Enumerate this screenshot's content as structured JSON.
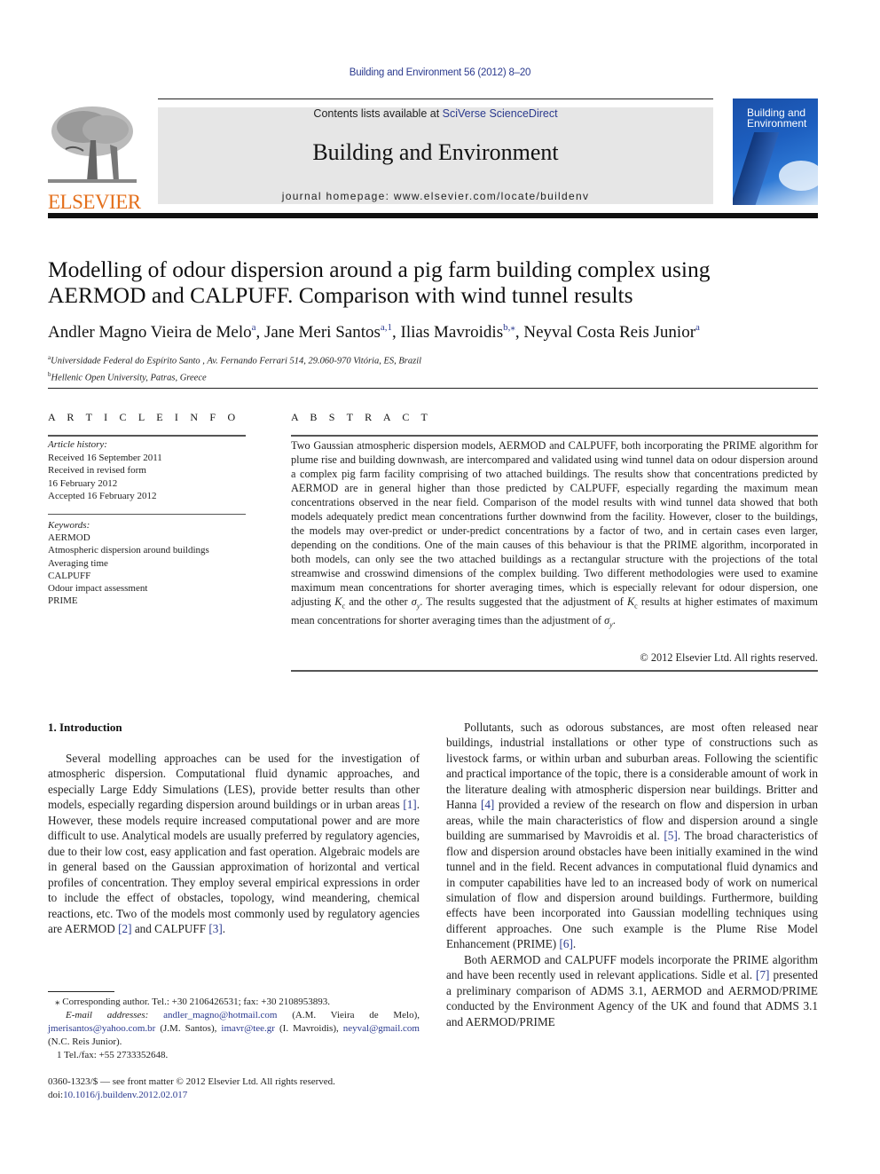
{
  "header": {
    "journal_ref": "Building and Environment 56 (2012) 8–20",
    "contents_prefix": "Contents lists available at ",
    "contents_link": "SciVerse ScienceDirect",
    "journal_title": "Building and Environment",
    "homepage": "journal homepage: www.elsevier.com/locate/buildenv",
    "publisher_logo_text": "ELSEVIER",
    "cover_title_line1": "Building and",
    "cover_title_line2": "Environment",
    "colors": {
      "link": "#2b3a8e",
      "elsevier_orange": "#e46f1b",
      "masthead_bg": "#e6e6e6"
    }
  },
  "article": {
    "title_line1": "Modelling of odour dispersion around a pig farm building complex using",
    "title_line2": "AERMOD and CALPUFF. Comparison with wind tunnel results",
    "authors": [
      {
        "name": "Andler Magno Vieira de Melo",
        "sup": "a"
      },
      {
        "name": "Jane Meri Santos",
        "sup": "a,1"
      },
      {
        "name": "Ilias Mavroidis",
        "sup": "b,⁎"
      },
      {
        "name": "Neyval Costa Reis Junior",
        "sup": "a"
      }
    ],
    "affiliations": [
      {
        "mark": "a",
        "text": "Universidade Federal do Espírito Santo , Av. Fernando Ferrari 514, 29.060-970 Vitória, ES, Brazil"
      },
      {
        "mark": "b",
        "text": "Hellenic Open University, Patras, Greece"
      }
    ]
  },
  "article_info": {
    "heading": "A R T I C L E   I N F O",
    "history_label": "Article history:",
    "history": [
      "Received 16 September 2011",
      "Received in revised form",
      "16 February 2012",
      "Accepted 16 February 2012"
    ],
    "keywords_label": "Keywords:",
    "keywords": [
      "AERMOD",
      "Atmospheric dispersion around buildings",
      "Averaging time",
      "CALPUFF",
      "Odour impact assessment",
      "PRIME"
    ]
  },
  "abstract": {
    "heading": "A B S T R A C T",
    "text_part1": "Two Gaussian atmospheric dispersion models, AERMOD and CALPUFF, both incorporating the PRIME algorithm for plume rise and building downwash, are intercompared and validated using wind tunnel data on odour dispersion around a complex pig farm facility comprising of two attached buildings. The results show that concentrations predicted by AERMOD are in general higher than those predicted by CALPUFF, especially regarding the maximum mean concentrations observed in the near field. Comparison of the model results with wind tunnel data showed that both models adequately predict mean concentrations further downwind from the facility. However, closer to the buildings, the models may over-predict or under-predict concentrations by a factor of two, and in certain cases even larger, depending on the conditions. One of the main causes of this behaviour is that the PRIME algorithm, incorporated in both models, can only see the two attached buildings as a rectangular structure with the projections of the total streamwise and crosswind dimensions of the complex building. Two different methodologies were used to examine maximum mean concentrations for shorter averaging times, which is especially relevant for odour dispersion, one adjusting ",
    "kc": "K",
    "kc_sub": "c",
    "text_part2": " and the other ",
    "sigma": "σ",
    "sigma_sub": "y",
    "text_part3": ". The results suggested that the adjustment of ",
    "text_part4": " results at higher estimates of maximum mean concentrations for shorter averaging times than the adjustment of ",
    "text_part5": ".",
    "copyright": "© 2012 Elsevier Ltd. All rights reserved."
  },
  "introduction": {
    "heading": "1.  Introduction",
    "left_p1_a": "Several modelling approaches can be used for the investigation of atmospheric dispersion. Computational fluid dynamic approaches, and especially Large Eddy Simulations (LES), provide better results than other models, especially regarding dispersion around buildings or in urban areas ",
    "ref1": "[1]",
    "left_p1_b": ". However, these models require increased computational power and are more difficult to use. Analytical models are usually preferred by regulatory agencies, due to their low cost, easy application and fast operation. Algebraic models are in general based on the Gaussian approximation of horizontal and vertical profiles of concentration. They employ several empirical expressions in order to include the effect of obstacles, topology, wind meandering, chemical reactions, etc. Two of the models most commonly used by regulatory agencies are AERMOD ",
    "ref2": "[2]",
    "left_p1_c": " and CALPUFF ",
    "ref3": "[3]",
    "left_p1_d": ".",
    "right_p1_a": "Pollutants, such as odorous substances, are most often released near buildings, industrial installations or other type of constructions such as livestock farms, or within urban and suburban areas. Following the scientific and practical importance of the topic, there is a considerable amount of work in the literature dealing with atmospheric dispersion near buildings. Britter and Hanna ",
    "ref4": "[4]",
    "right_p1_b": " provided a review of the research on flow and dispersion in urban areas, while the main characteristics of flow and dispersion around a single building are summarised by Mavroidis et al. ",
    "ref5": "[5]",
    "right_p1_c": ". The broad characteristics of flow and dispersion around obstacles have been initially examined in the wind tunnel and in the field. Recent advances in computational fluid dynamics and in computer capabilities have led to an increased body of work on numerical simulation of flow and dispersion around buildings. Furthermore, building effects have been incorporated into Gaussian modelling techniques using different approaches. One such example is the Plume Rise Model Enhancement (PRIME) ",
    "ref6": "[6]",
    "right_p1_d": ".",
    "right_p2_a": "Both AERMOD and CALPUFF models incorporate the PRIME algorithm and have been recently used in relevant applications. Sidle et al. ",
    "ref7": "[7]",
    "right_p2_b": " presented a preliminary comparison of ADMS 3.1, AERMOD and AERMOD/PRIME conducted by the Environment Agency of the UK and found that ADMS 3.1 and AERMOD/PRIME"
  },
  "footnotes": {
    "corresponding": "⁎  Corresponding author. Tel.: +30 2106426531; fax: +30 2108953893.",
    "email_label": "E-mail addresses:",
    "emails": [
      {
        "address": "andler_magno@hotmail.com",
        "who": " (A.M. Vieira de Melo), "
      },
      {
        "address": "jmerisantos@yahoo.com.br",
        "who": " (J.M. Santos), "
      },
      {
        "address": "imavr@tee.gr",
        "who": " (I. Mavroidis), "
      },
      {
        "address": "neyval@gmail.com",
        "who": " (N.C. Reis Junior)."
      }
    ],
    "note1": "1  Tel./fax: +55 2733352648."
  },
  "front_matter": {
    "issn_line": "0360-1323/$ — see front matter © 2012 Elsevier Ltd. All rights reserved.",
    "doi_prefix": "doi:",
    "doi": "10.1016/j.buildenv.2012.02.017"
  }
}
